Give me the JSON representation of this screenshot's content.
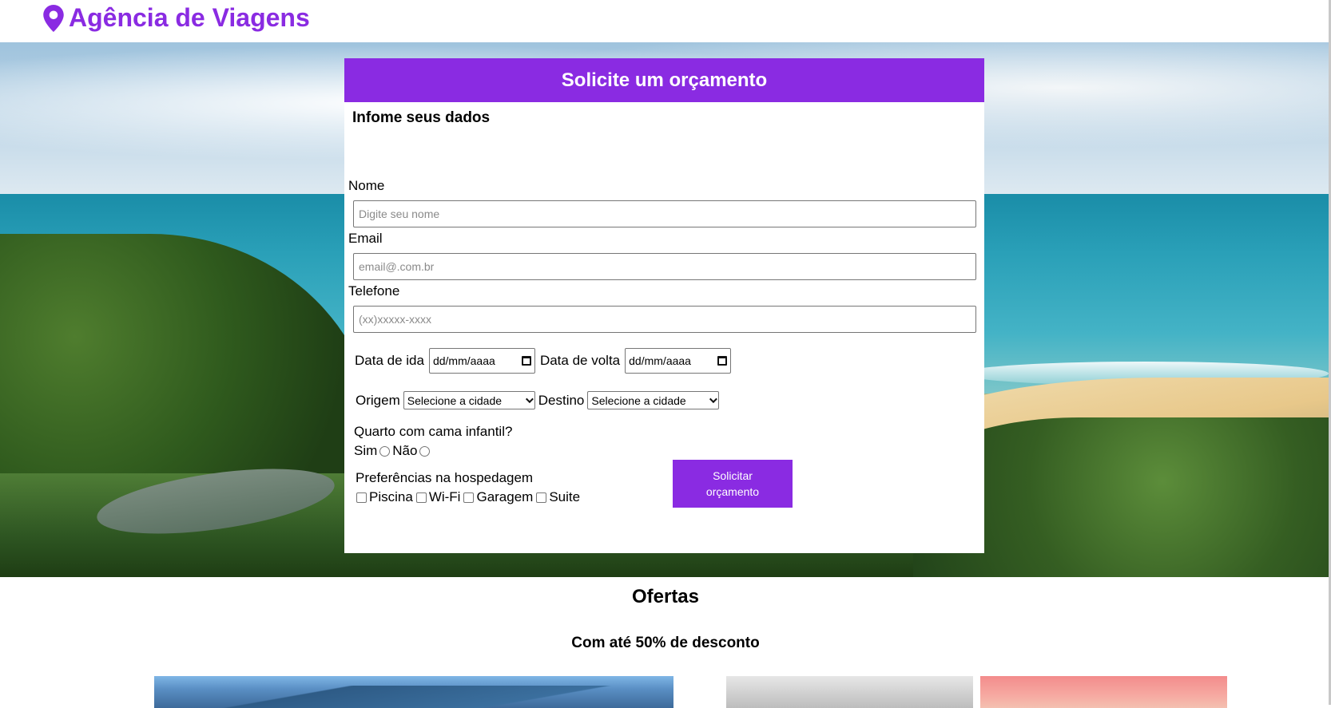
{
  "header": {
    "brand_icon": "map-pin-icon",
    "brand_title": "Agência de Viagens",
    "accent_color": "#8a2be2"
  },
  "form": {
    "title": "Solicite um orçamento",
    "subtitle": "Infome seus dados",
    "name_label": "Nome",
    "name_placeholder": "Digite seu nome",
    "email_label": "Email",
    "email_placeholder": "email@.com.br",
    "phone_label": "Telefone",
    "phone_placeholder": "(xx)xxxxx-xxxx",
    "departure_label": "Data de ida",
    "departure_value": "dd/mm/aaaa",
    "return_label": "Data de volta",
    "return_value": "dd/mm/aaaa",
    "origin_label": "Origem",
    "origin_value": "Selecione a cidade",
    "destination_label": "Destino",
    "destination_value": "Selecione a cidade",
    "crib_question": "Quarto com cama infantil?",
    "crib_yes": "Sim",
    "crib_no": "Não",
    "prefs_label": "Preferências na hospedagem",
    "prefs": [
      "Piscina",
      "Wi-Fi",
      "Garagem",
      "Suite"
    ],
    "submit_label": "Solicitar orçamento"
  },
  "offers": {
    "title": "Ofertas",
    "subtitle": "Com até 50% de desconto"
  }
}
